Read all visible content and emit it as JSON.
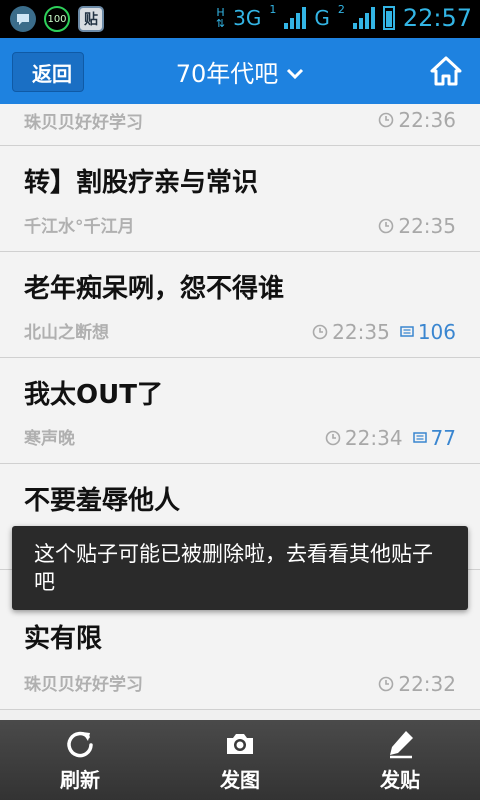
{
  "status_bar": {
    "network_primary": "3G",
    "network_secondary": "G",
    "h_label": "H",
    "sim1": "1",
    "sim2": "2",
    "notif_badge": "100",
    "tieba_icon_text": "贴",
    "time": "22:57"
  },
  "header": {
    "back_label": "返回",
    "title": "70年代吧",
    "title_chevron": "⌄",
    "colors": {
      "header_bg": "#1e82e0",
      "accent": "#3a86d0"
    }
  },
  "posts": [
    {
      "title": "",
      "author": "珠贝贝好好学习",
      "time": "22:36",
      "replies": ""
    },
    {
      "title": "转】割股疗亲与常识",
      "author": "千江水°千江月",
      "time": "22:35",
      "replies": ""
    },
    {
      "title": "老年痴呆咧，怨不得谁",
      "author": "北山之断想",
      "time": "22:35",
      "replies": "106"
    },
    {
      "title": "我太OUT了",
      "author": "寒声晚",
      "time": "22:34",
      "replies": "77"
    },
    {
      "title": "不要羞辱他人",
      "author": "",
      "time": "",
      "replies": ""
    },
    {
      "title": "实有限",
      "author": "珠贝贝好好学习",
      "time": "22:32",
      "replies": ""
    }
  ],
  "toast": {
    "message": "这个贴子可能已被删除啦，去看看其他贴子吧"
  },
  "bottom_bar": {
    "refresh_label": "刷新",
    "photo_label": "发图",
    "post_label": "发贴"
  }
}
